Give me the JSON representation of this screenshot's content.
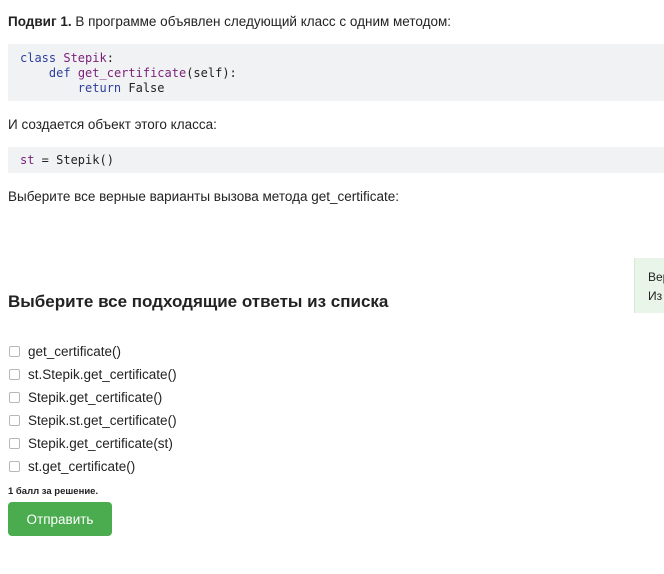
{
  "task": {
    "title": "Подвиг 1.",
    "text": "В программе объявлен следующий класс с одним методом:"
  },
  "code1": {
    "line1": {
      "kw": "class",
      "name": "Stepik",
      "rest": ":"
    },
    "line2": {
      "indent": "    ",
      "kw": "def",
      "name": "get_certificate",
      "rest": "(self):"
    },
    "line3": {
      "indent": "        ",
      "kw": "return",
      "rest": " False"
    }
  },
  "para2": "И создается объект этого класса:",
  "code2": {
    "var": "st",
    "rest": " = Stepik()"
  },
  "para3": "Выберите все верные варианты вызова метода get_certificate:",
  "side_note": {
    "line1": "Вер",
    "line2": "Из"
  },
  "question": {
    "heading": "Выберите все подходящие ответы из списка"
  },
  "options": [
    {
      "label": "get_certificate()",
      "checked": false
    },
    {
      "label": "st.Stepik.get_certificate()",
      "checked": false
    },
    {
      "label": "Stepik.get_certificate()",
      "checked": false
    },
    {
      "label": "Stepik.st.get_certificate()",
      "checked": false
    },
    {
      "label": "Stepik.get_certificate(st)",
      "checked": false
    },
    {
      "label": "st.get_certificate()",
      "checked": false
    }
  ],
  "score_text": "1 балл за решение.",
  "submit_label": "Отправить",
  "colors": {
    "submit": "#4bab4f",
    "code_bg": "#f1f2f3",
    "note_bg": "#eaf5ea"
  }
}
